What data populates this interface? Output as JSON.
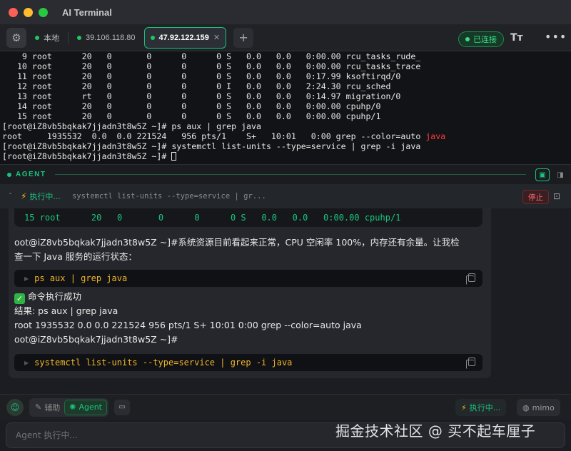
{
  "window": {
    "title": "AI Terminal"
  },
  "tabs": [
    {
      "label": "本地",
      "active": false,
      "closable": false
    },
    {
      "label": "39.106.118.80",
      "active": false,
      "closable": false
    },
    {
      "label": "47.92.122.159",
      "active": true,
      "closable": true,
      "close_label": "✕"
    }
  ],
  "tabbar": {
    "add_label": "+",
    "status": "已连接",
    "font_label": "Tт",
    "more_label": "•••",
    "settings_icon": "gear-icon"
  },
  "terminal": {
    "lines": [
      "    9 root      20   0       0      0      0 S   0.0   0.0   0:00.00 rcu_tasks_rude_",
      "   10 root      20   0       0      0      0 S   0.0   0.0   0:00.00 rcu_tasks_trace",
      "   11 root      20   0       0      0      0 S   0.0   0.0   0:17.99 ksoftirqd/0",
      "   12 root      20   0       0      0      0 I   0.0   0.0   2:24.30 rcu_sched",
      "   13 root      rt   0       0      0      0 S   0.0   0.0   0:14.97 migration/0",
      "   14 root      20   0       0      0      0 S   0.0   0.0   0:00.00 cpuhp/0",
      "   15 root      20   0       0      0      0 S   0.0   0.0   0:00.00 cpuhp/1",
      "[root@iZ8vb5bqkak7jjadn3t8w5Z ~]# ps aux | grep java"
    ],
    "grep_line_prefix": "root     1935532  0.0  0.0 221524   956 pts/1    S+   10:01   0:00 grep --color=auto ",
    "grep_line_match": "java",
    "line_after": "[root@iZ8vb5bqkak7jjadn3t8w5Z ~]# systemctl list-units --type=service | grep -i java",
    "prompt": "[root@iZ8vb5bqkak7jjadn3t8w5Z ~]# "
  },
  "agent": {
    "header_label": "AGENT",
    "exec": {
      "label": "执行中...",
      "command": "systemctl list-units --type=service | gr...",
      "stop_label": "停止"
    },
    "chat": {
      "code_tail": "15 root      20   0       0      0      0 S   0.0   0.0   0:00.00 cpuhp/1",
      "message_line1": "oot@iZ8vb5bqkak7jjadn3t8w5Z ~]#系统资源目前看起来正常，CPU 空闲率 100%，内存还有余量。让我检",
      "message_line2": "查一下 Java 服务的运行状态：",
      "cmd1": "ps aux | grep java",
      "success_icon": "✓",
      "success_text": "命令执行成功",
      "result_label": "结果: ps aux | grep java",
      "result_line": "root     1935532  0.0  0.0 221524   956 pts/1    S+   10:01   0:00 grep --color=auto java",
      "result_prompt": "oot@iZ8vb5bqkak7jjadn3t8w5Z ~]#",
      "cmd2": "systemctl list-units --type=service | grep -i java"
    }
  },
  "toolbar": {
    "mode_assist": "辅助",
    "mode_agent": "Agent",
    "run_label": "执行中...",
    "model_label": "mimo"
  },
  "input": {
    "placeholder": "Agent 执行中..."
  },
  "watermark": "掘金技术社区 @ 买不起车厘子",
  "colors": {
    "accent": "#19c37d",
    "warning": "#f0b429",
    "danger": "#ff3b3b",
    "background": "#1b1d22"
  }
}
